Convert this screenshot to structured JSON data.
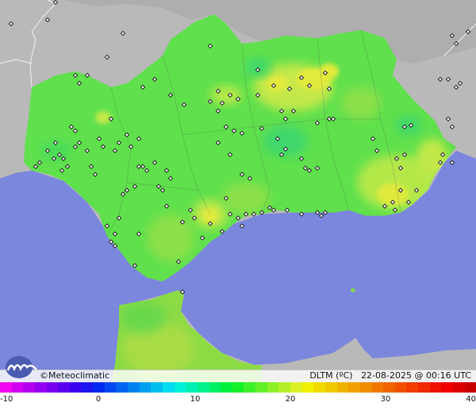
{
  "footer": {
    "brand_symbol": "©",
    "brand": "Meteoclimatic",
    "variable_label": "DLTM (ºC)",
    "timestamp": "22-08-2025 @ 00:16 UTC"
  },
  "scale": {
    "ticks": [
      "-10",
      "0",
      "10",
      "20",
      "30",
      "40"
    ],
    "min": -10,
    "max": 40,
    "colors": [
      "#f005f0",
      "#d200f0",
      "#b400f0",
      "#9600f0",
      "#7800f0",
      "#5a00f0",
      "#3c00f0",
      "#1e14f0",
      "#0028f0",
      "#0046f0",
      "#0064f0",
      "#0082f0",
      "#00a0f0",
      "#00bef0",
      "#00dcf0",
      "#00f0dc",
      "#00f0b4",
      "#00f08c",
      "#00f064",
      "#00f03c",
      "#14f028",
      "#3cf028",
      "#64f028",
      "#8cf028",
      "#b4f028",
      "#dcf028",
      "#f0f000",
      "#f0dc00",
      "#f0c800",
      "#f0b400",
      "#f0a000",
      "#f08c00",
      "#f07800",
      "#f06400",
      "#f05000",
      "#f03c00",
      "#f02800",
      "#f01400",
      "#f00000",
      "#dc0000",
      "#c80000"
    ]
  },
  "map_colors": {
    "sea": "#7b86dd",
    "land_outside": "#b9b9b9",
    "region_base": "#5fe04c",
    "warm_patch": "#c4e84a",
    "hot_patch": "#e2ea3c",
    "cool_patch": "#3fd76c",
    "station_marker": "#ffffff"
  },
  "logo_icon": "meteoclimatic-logo-icon",
  "station_icon": "station-marker-icon"
}
